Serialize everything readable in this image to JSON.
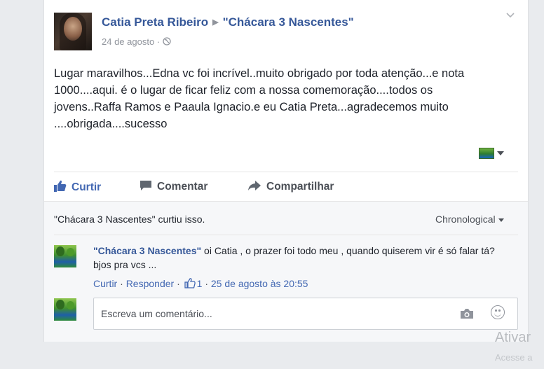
{
  "post": {
    "author": "Catia Preta Ribeiro",
    "separator_icon": "triangle-right-icon",
    "target_page": "\"Chácara 3 Nascentes\"",
    "date": "24 de agosto",
    "dot": " · ",
    "privacy_icon": "globe-icon",
    "options_icon": "chevron-down-icon",
    "body": "Lugar maravilhos...Edna vc foi incrível..muito obrigado por toda atenção...e nota 1000....aqui. é o lugar de ficar feliz com a nossa comemoração....todos os jovens..Raffa Ramos e Paaula Ignacio.e eu Catia Preta...agradecemos muito ....obrigada....sucesso"
  },
  "actions": {
    "like": "Curtir",
    "comment": "Comentar",
    "share": "Compartilhar"
  },
  "likes_summary": "\"Chácara 3 Nascentes\" curtiu isso.",
  "sort": {
    "selected": "Chronological"
  },
  "comments": [
    {
      "author": "\"Chácara 3 Nascentes\"",
      "text": " oi Catia , o prazer foi todo meu , quando quiserem vir é só falar tá? bjos pra vcs ...",
      "like_label": "Curtir",
      "reply_label": "Responder",
      "like_count": "1",
      "timestamp": "25 de agosto às 20:55"
    }
  ],
  "composer": {
    "placeholder": "Escreva um comentário...",
    "camera_icon": "camera-icon",
    "emoji_icon": "emoji-icon"
  },
  "watermark": {
    "line1": "Ativar",
    "line2": "Acesse a"
  },
  "colors": {
    "link": "#365899",
    "accent": "#4267b2",
    "background": "#e9ebee"
  }
}
